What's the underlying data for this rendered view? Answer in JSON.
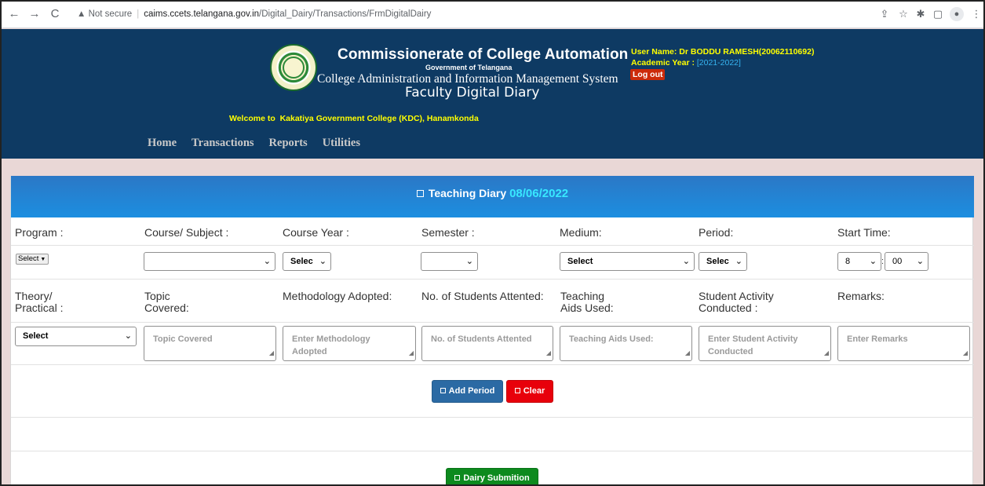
{
  "browser": {
    "security_label": "Not secure",
    "url_host": "caims.ccets.telangana.gov.in",
    "url_path": "/Digital_Dairy/Transactions/FrmDigitalDairy"
  },
  "header": {
    "org_title": "Commissionerate of College Automation",
    "org_subtitle": "Government of Telangana",
    "system_name": "College Administration and Information Management System",
    "diary_title": "Faculty Digital Diary",
    "user_label": "User Name:",
    "user_value": "Dr BODDU RAMESH(20062110692)",
    "year_label": "Academic Year :",
    "year_value": "[2021-2022]",
    "logout_label": "Log out",
    "welcome_prefix": "Welcome to",
    "welcome_college": "Kakatiya Government College (KDC), Hanamkonda"
  },
  "menu": {
    "items": [
      "Home",
      "Transactions",
      "Reports",
      "Utilities"
    ]
  },
  "panel": {
    "title": "Teaching Diary",
    "date": "08/06/2022"
  },
  "row1": {
    "labels": [
      "Program :",
      "Course/ Subject :",
      "Course Year :",
      "Semester :",
      "Medium:",
      "Period:",
      "Start Time:"
    ],
    "program_value": "Select",
    "course_value": "",
    "course_year_value": "Selec",
    "semester_value": "",
    "medium_value": "Select",
    "period_value": "Selec",
    "start_hour": "8",
    "start_min": "00",
    "time_sep": ":"
  },
  "row2": {
    "labels": {
      "theory": [
        "Theory/",
        "Practical :"
      ],
      "topic": [
        "Topic",
        "Covered:"
      ],
      "methodology": "Methodology Adopted:",
      "students": "No. of Students Attented:",
      "aids": [
        "Teaching",
        "Aids Used:"
      ],
      "activity": [
        "Student Activity",
        "Conducted :"
      ],
      "remarks": "Remarks:"
    },
    "theory_value": "Select",
    "placeholders": {
      "topic": "Topic Covered",
      "methodology": "Enter Methodology Adopted",
      "students": "No. of Students Attented",
      "aids": "Teaching Aids Used:",
      "activity": "Enter Student Activity Conducted",
      "remarks": "Enter Remarks"
    }
  },
  "buttons": {
    "add_period": "Add Period",
    "clear": "Clear",
    "submit": "Dairy Submition"
  },
  "colors": {
    "header_bg": "#0e3a63",
    "panel_head": "#2481d3",
    "add_btn": "#2b6aa4",
    "clear_btn": "#e8000b",
    "submit_btn": "#0d8a1e",
    "yellow_text": "#ffff00"
  }
}
